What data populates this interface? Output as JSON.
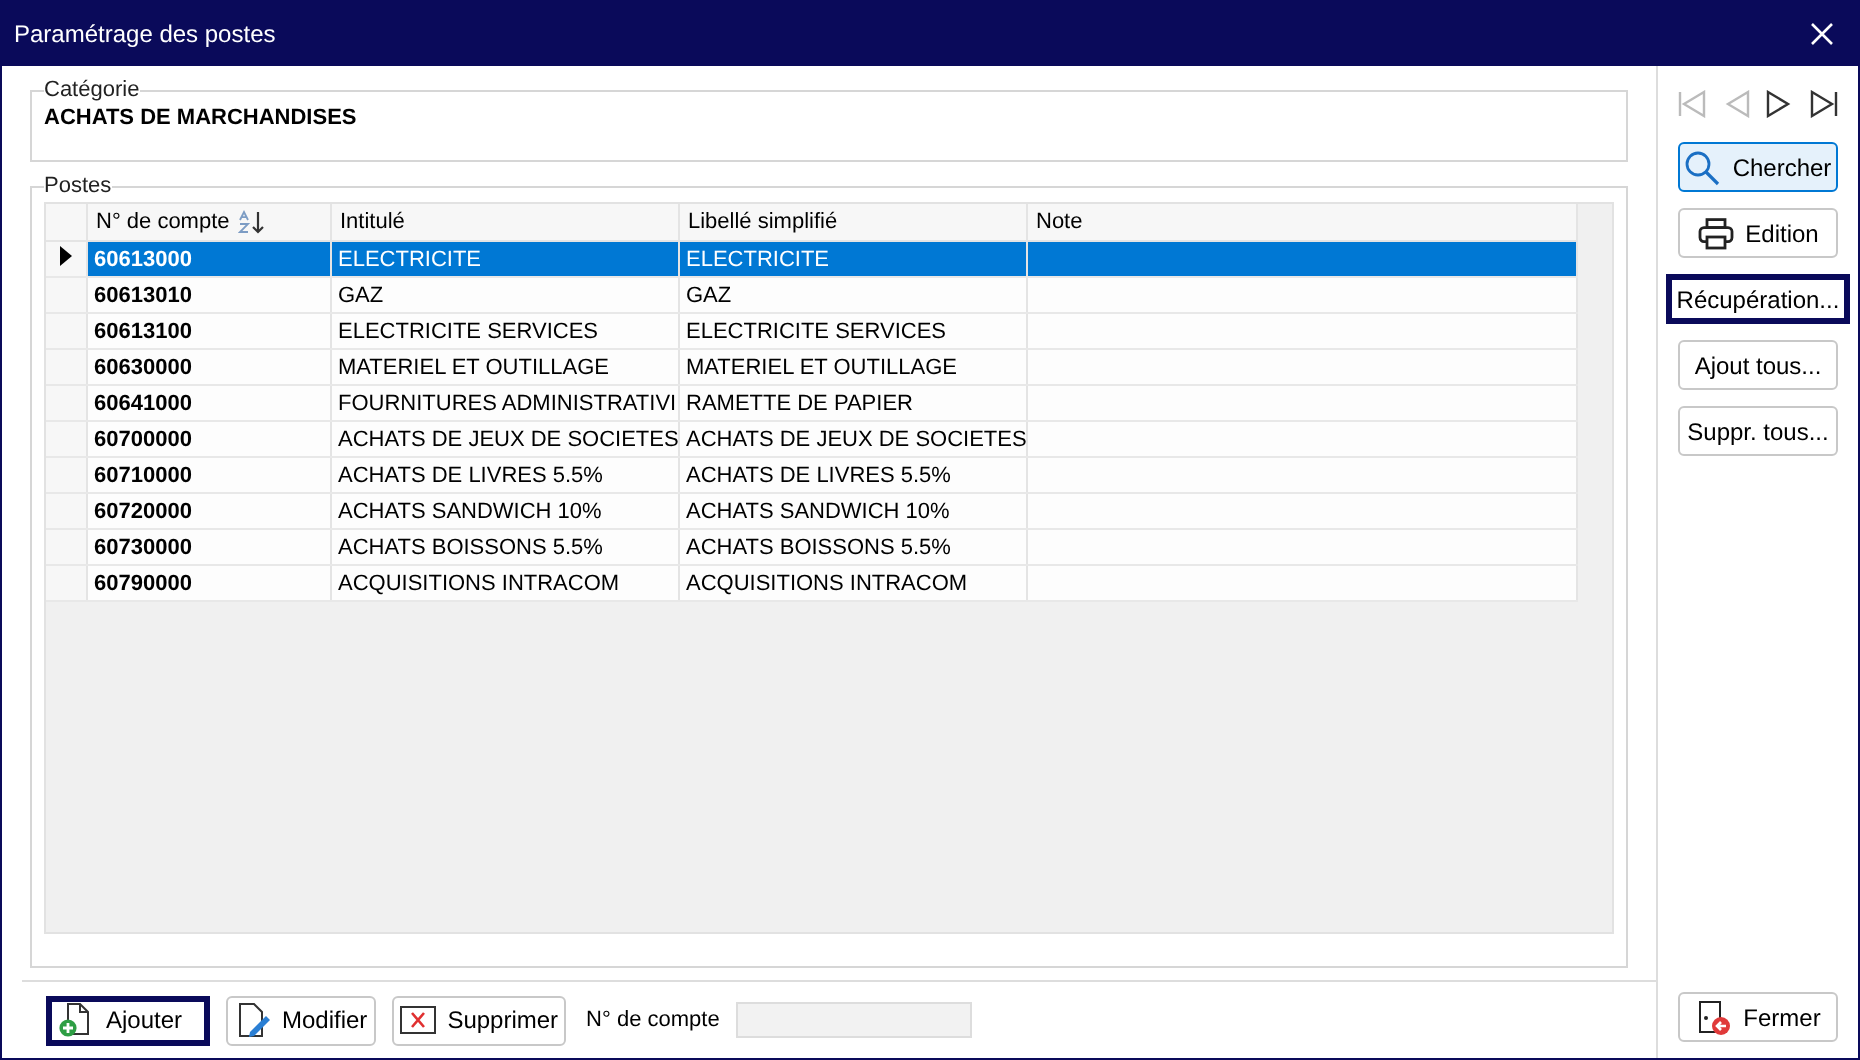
{
  "window": {
    "title": "Paramétrage des postes"
  },
  "category": {
    "legend": "Catégorie",
    "value": "ACHATS DE MARCHANDISES"
  },
  "postes": {
    "legend": "Postes",
    "columns": [
      {
        "label": "N° de compte",
        "sorted": true
      },
      {
        "label": "Intitulé",
        "sorted": false
      },
      {
        "label": "Libellé simplifié",
        "sorted": false
      },
      {
        "label": "Note",
        "sorted": false
      }
    ],
    "rows": [
      {
        "cells": [
          "60613000",
          "ELECTRICITE",
          "ELECTRICITE",
          ""
        ],
        "selected": true
      },
      {
        "cells": [
          "60613010",
          "GAZ",
          "GAZ",
          ""
        ],
        "selected": false
      },
      {
        "cells": [
          "60613100",
          "ELECTRICITE SERVICES",
          "ELECTRICITE SERVICES",
          ""
        ],
        "selected": false
      },
      {
        "cells": [
          "60630000",
          "MATERIEL ET OUTILLAGE",
          "MATERIEL ET OUTILLAGE",
          ""
        ],
        "selected": false
      },
      {
        "cells": [
          "60641000",
          "FOURNITURES ADMINISTRATIVI",
          "RAMETTE DE PAPIER",
          ""
        ],
        "selected": false
      },
      {
        "cells": [
          "60700000",
          "ACHATS DE JEUX DE SOCIETES",
          "ACHATS DE JEUX DE SOCIETES",
          ""
        ],
        "selected": false
      },
      {
        "cells": [
          "60710000",
          "ACHATS DE LIVRES  5.5%",
          "ACHATS DE LIVRES  5.5%",
          ""
        ],
        "selected": false
      },
      {
        "cells": [
          "60720000",
          "ACHATS SANDWICH 10%",
          "ACHATS SANDWICH 10%",
          ""
        ],
        "selected": false
      },
      {
        "cells": [
          "60730000",
          "ACHATS BOISSONS 5.5%",
          "ACHATS BOISSONS 5.5%",
          ""
        ],
        "selected": false
      },
      {
        "cells": [
          "60790000",
          "ACQUISITIONS INTRACOM",
          "ACQUISITIONS INTRACOM",
          ""
        ],
        "selected": false
      }
    ]
  },
  "navigation": [
    {
      "kind": "first",
      "enabled": false
    },
    {
      "kind": "prev",
      "enabled": false
    },
    {
      "kind": "next",
      "enabled": true
    },
    {
      "kind": "last",
      "enabled": true
    }
  ],
  "side_buttons": [
    {
      "label": "Chercher",
      "kind": "search",
      "focused": false,
      "hovered": true
    },
    {
      "label": "Edition",
      "kind": "print",
      "focused": false,
      "hovered": false
    },
    {
      "label": "Récupération...",
      "kind": "text",
      "focused": true,
      "hovered": false
    },
    {
      "label": "Ajout tous...",
      "kind": "text",
      "focused": false,
      "hovered": false
    },
    {
      "label": "Suppr. tous...",
      "kind": "text",
      "focused": false,
      "hovered": false
    }
  ],
  "bottom_buttons": [
    {
      "label": "Ajouter",
      "kind": "add",
      "focused": true,
      "hovered": false
    },
    {
      "label": "Modifier",
      "kind": "edit",
      "focused": false,
      "hovered": false
    },
    {
      "label": "Supprimer",
      "kind": "delete",
      "focused": false,
      "hovered": false
    }
  ],
  "account_field": {
    "label": "N° de compte",
    "disabled": true
  },
  "close_button": {
    "label": "Fermer",
    "kind": "exit",
    "focused": false,
    "hovered": false
  }
}
